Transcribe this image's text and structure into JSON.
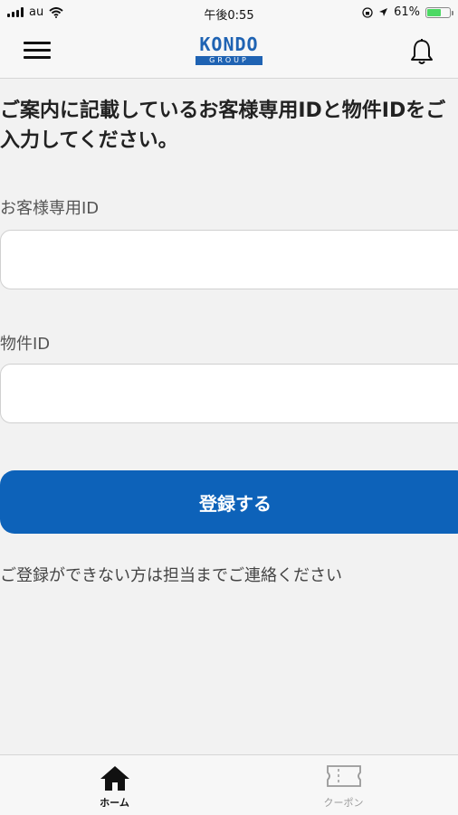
{
  "status_bar": {
    "carrier": "au",
    "time": "午後0:55",
    "battery_percent": "61%",
    "battery_level": 0.61,
    "battery_color": "#4cd964"
  },
  "nav": {
    "logo_main": "KONDO",
    "logo_sub": "GROUP",
    "menu_icon": "hamburger-menu-icon",
    "notification_icon": "bell-icon",
    "brand_color": "#1f63b3"
  },
  "form": {
    "intro": "ご案内に記載しているお客様専用IDと物件IDをご入力してください。",
    "customer_id_label": "お客様専用ID",
    "customer_id_value": "",
    "property_id_label": "物件ID",
    "property_id_value": "",
    "submit_label": "登録する",
    "submit_color": "#0d62b9",
    "help_text": "ご登録ができない方は担当までご連絡ください"
  },
  "tabs": [
    {
      "label": "ホーム",
      "icon": "home-icon",
      "active": true
    },
    {
      "label": "クーポン",
      "icon": "coupon-icon",
      "active": false
    }
  ]
}
